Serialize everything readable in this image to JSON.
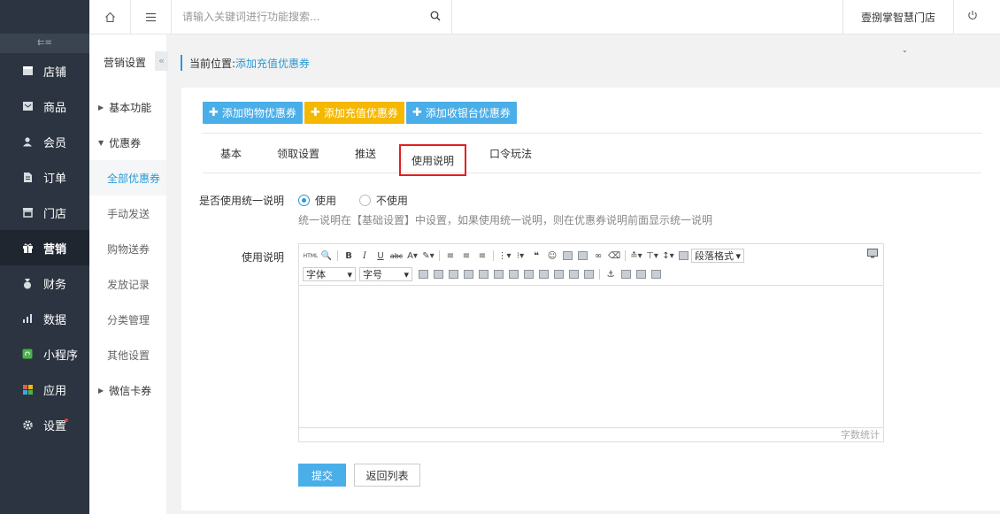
{
  "colors": {
    "primary": "#2a9ad6",
    "btn_blue": "#4aaee8",
    "btn_orange": "#f5b800",
    "sidebar_bg": "#2b3440",
    "highlight_red": "#e02020"
  },
  "sidebar": {
    "toggle_icon": "menu-collapse-icon",
    "items": [
      {
        "label": "店铺",
        "icon": "store-icon"
      },
      {
        "label": "商品",
        "icon": "goods-icon"
      },
      {
        "label": "会员",
        "icon": "member-icon"
      },
      {
        "label": "订单",
        "icon": "order-icon"
      },
      {
        "label": "门店",
        "icon": "shop-icon"
      },
      {
        "label": "营销",
        "icon": "gift-icon",
        "active": true
      },
      {
        "label": "财务",
        "icon": "finance-icon"
      },
      {
        "label": "数据",
        "icon": "data-chart-icon"
      },
      {
        "label": "小程序",
        "icon": "miniprogram-icon"
      },
      {
        "label": "应用",
        "icon": "apps-icon"
      },
      {
        "label": "设置",
        "icon": "settings-gear-icon",
        "badge_dot": true
      }
    ]
  },
  "topbar": {
    "search_placeholder": "请输入关键词进行功能搜索...",
    "store_name": "壹捌掌智慧门店"
  },
  "submenu": {
    "title": "营销设置",
    "groups": [
      {
        "label": "基本功能",
        "expanded": false
      },
      {
        "label": "优惠券",
        "expanded": true
      }
    ],
    "items": [
      "全部优惠券",
      "手动发送",
      "购物送券",
      "发放记录",
      "分类管理",
      "其他设置"
    ],
    "wechat_group": "微信卡券"
  },
  "breadcrumb": {
    "label": "当前位置:",
    "current": "添加充值优惠券"
  },
  "actions": {
    "add_shopping": "添加购物优惠券",
    "add_recharge": "添加充值优惠券",
    "add_cashier": "添加收银台优惠券"
  },
  "tabs": [
    "基本",
    "领取设置",
    "推送",
    "使用说明",
    "口令玩法"
  ],
  "form": {
    "unified_label": "是否使用统一说明",
    "opt_yes": "使用",
    "opt_no": "不使用",
    "hint": "统一说明在【基础设置】中设置，如果使用统一说明，则在优惠券说明前面显示统一说明",
    "desc_label": "使用说明",
    "font_select": "字体",
    "size_select": "字号",
    "paragraph_select": "段落格式",
    "word_count": "字数统计",
    "submit": "提交",
    "back": "返回列表"
  }
}
